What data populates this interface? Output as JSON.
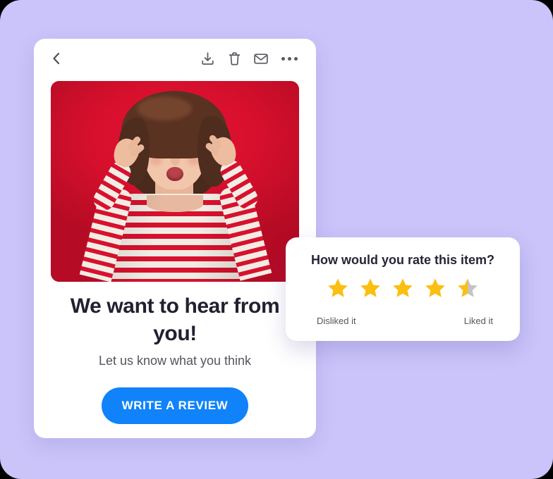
{
  "theme": {
    "page_background": "#cac4fa",
    "card_background": "#ffffff",
    "accent_blue": "#1082fa",
    "star_gold": "#fbbf11",
    "star_gray": "#c4c4c4",
    "photo_red": "#d8102d",
    "heading_color": "#231f30",
    "muted_text": "#55545c"
  },
  "toolbar": {
    "back_icon": "chevron-left-icon",
    "actions": [
      {
        "icon": "download-icon",
        "name": "download-button"
      },
      {
        "icon": "trash-icon",
        "name": "delete-button"
      },
      {
        "icon": "envelope-icon",
        "name": "mail-button"
      },
      {
        "icon": "more-horizontal-icon",
        "name": "more-options-button"
      }
    ]
  },
  "hero": {
    "alt": "Woman wearing white sunglasses and a red striped shirt on a red background"
  },
  "main": {
    "headline": "We want to hear from you!",
    "subheadline": "Let us know what you think",
    "cta_label": "WRITE A REVIEW"
  },
  "rating_popover": {
    "title": "How would you rate this item?",
    "low_label": "Disliked it",
    "high_label": "Liked it",
    "value": 4.5,
    "max": 5,
    "stars": [
      "full",
      "full",
      "full",
      "full",
      "half"
    ]
  }
}
